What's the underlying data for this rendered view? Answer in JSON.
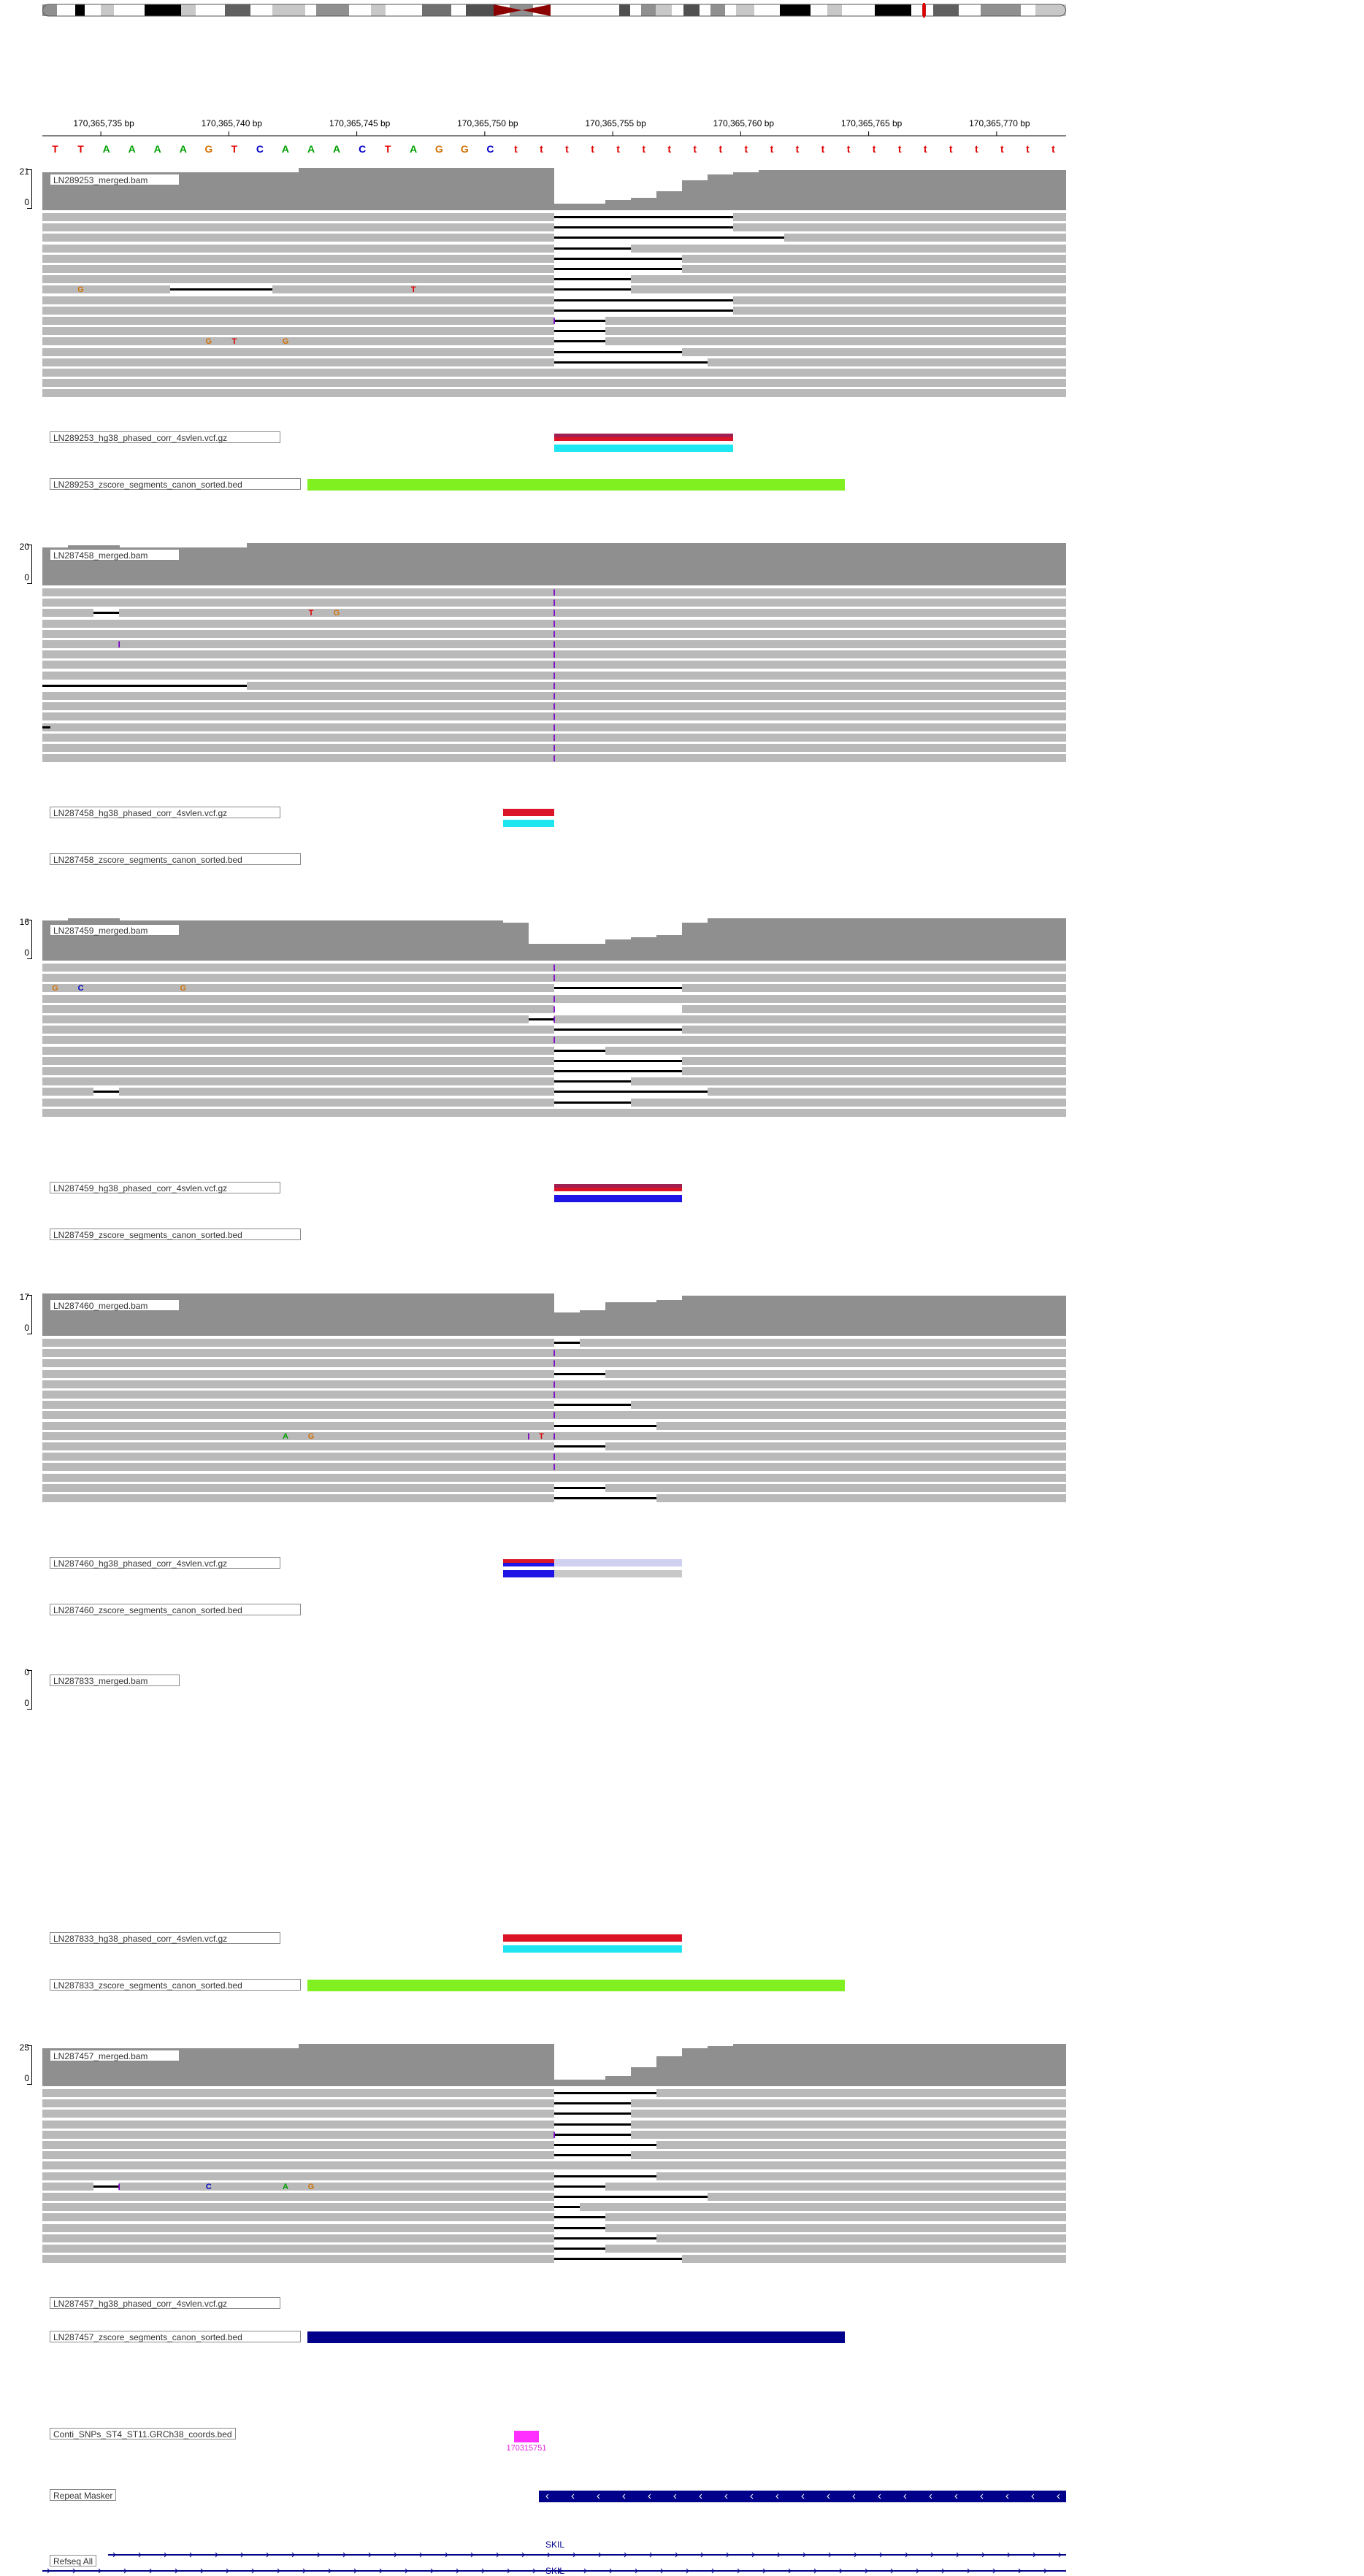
{
  "ruler": {
    "positions": [
      "170,365,735 bp",
      "170,365,740 bp",
      "170,365,745 bp",
      "170,365,750 bp",
      "170,365,755 bp",
      "170,365,760 bp",
      "170,365,765 bp",
      "170,365,770 bp"
    ]
  },
  "sequence": {
    "bases": [
      "T",
      "T",
      "A",
      "A",
      "A",
      "A",
      "G",
      "T",
      "C",
      "A",
      "A",
      "A",
      "C",
      "T",
      "A",
      "G",
      "G",
      "C",
      "t",
      "t",
      "t",
      "t",
      "t",
      "t",
      "t",
      "t",
      "t",
      "t",
      "t",
      "t",
      "t",
      "t",
      "t",
      "t",
      "t",
      "t",
      "t",
      "t",
      "t",
      "t"
    ],
    "colors": {
      "A": "#00a000",
      "C": "#0000c8",
      "G": "#d17105",
      "T": "#e00000",
      "t": "#e00000"
    }
  },
  "samples": [
    {
      "id": "LN289253",
      "bam_label": "LN289253_merged.bam",
      "scale_max": "21",
      "scale_min": "0",
      "vcf_label": "LN289253_hg38_phased_corr_4svlen.vcf.gz",
      "bed_label": "LN289253_zscore_segments_canon_sorted.bed",
      "coverage": [
        0.9,
        0.9,
        0.9,
        0.9,
        0.9,
        0.9,
        0.9,
        0.9,
        0.9,
        0.9,
        1,
        1,
        1,
        1,
        1,
        1,
        1,
        1,
        1,
        1,
        0.15,
        0.15,
        0.25,
        0.3,
        0.45,
        0.7,
        0.85,
        0.9,
        0.95,
        0.95,
        0.95,
        0.95,
        0.95,
        0.95,
        0.95,
        0.95,
        0.95,
        0.95,
        0.95,
        0.95
      ]
    },
    {
      "id": "LN287458",
      "bam_label": "LN287458_merged.bam",
      "scale_max": "20",
      "scale_min": "0",
      "vcf_label": "LN287458_hg38_phased_corr_4svlen.vcf.gz",
      "bed_label": "LN287458_zscore_segments_canon_sorted.bed",
      "coverage": [
        0.9,
        0.95,
        0.95,
        0.9,
        0.9,
        0.9,
        0.9,
        0.9,
        1,
        1,
        1,
        1,
        1,
        1,
        1,
        1,
        1,
        1,
        1,
        1,
        1,
        1,
        1,
        1,
        1,
        1,
        1,
        1,
        1,
        1,
        1,
        1,
        1,
        1,
        1,
        1,
        1,
        1,
        1,
        1
      ]
    },
    {
      "id": "LN287459",
      "bam_label": "LN287459_merged.bam",
      "scale_max": "16",
      "scale_min": "0",
      "vcf_label": "LN287459_hg38_phased_corr_4svlen.vcf.gz",
      "bed_label": "LN287459_zscore_segments_canon_sorted.bed",
      "coverage": [
        0.95,
        1,
        1,
        0.95,
        0.95,
        0.95,
        0.95,
        0.95,
        0.95,
        0.95,
        0.95,
        0.95,
        0.95,
        0.95,
        0.95,
        0.95,
        0.95,
        0.95,
        0.9,
        0.4,
        0.4,
        0.4,
        0.5,
        0.55,
        0.6,
        0.9,
        1,
        1,
        1,
        1,
        1,
        1,
        1,
        1,
        1,
        1,
        1,
        1,
        1,
        1
      ]
    },
    {
      "id": "LN287460",
      "bam_label": "LN287460_merged.bam",
      "scale_max": "17",
      "scale_min": "0",
      "vcf_label": "LN287460_hg38_phased_corr_4svlen.vcf.gz",
      "bed_label": "LN287460_zscore_segments_canon_sorted.bed",
      "coverage": [
        1,
        1,
        1,
        1,
        1,
        1,
        1,
        1,
        1,
        1,
        1,
        1,
        1,
        1,
        1,
        1,
        1,
        1,
        1,
        1,
        0.55,
        0.6,
        0.8,
        0.8,
        0.85,
        0.95,
        0.95,
        0.95,
        0.95,
        0.95,
        0.95,
        0.95,
        0.95,
        0.95,
        0.95,
        0.95,
        0.95,
        0.95,
        0.95,
        0.95
      ]
    },
    {
      "id": "LN287833",
      "bam_label": "LN287833_merged.bam",
      "scale_max": "0",
      "scale_min": "0",
      "vcf_label": "LN287833_hg38_phased_corr_4svlen.vcf.gz",
      "bed_label": "LN287833_zscore_segments_canon_sorted.bed",
      "coverage": []
    },
    {
      "id": "LN287457",
      "bam_label": "LN287457_merged.bam",
      "scale_max": "25",
      "scale_min": "0",
      "vcf_label": "LN287457_hg38_phased_corr_4svlen.vcf.gz",
      "bed_label": "LN287457_zscore_segments_canon_sorted.bed",
      "coverage": [
        0.9,
        0.9,
        0.9,
        0.9,
        0.9,
        0.9,
        0.9,
        0.9,
        0.9,
        0.9,
        1,
        1,
        1,
        1,
        1,
        1,
        1,
        1,
        1,
        1,
        0.15,
        0.15,
        0.25,
        0.45,
        0.7,
        0.9,
        0.95,
        1,
        1,
        1,
        1,
        1,
        1,
        1,
        1,
        1,
        1,
        1,
        1,
        1
      ]
    }
  ],
  "annotation_tracks": {
    "snps_label": "Conti_SNPs_ST4_ST11.GRCh38_coords.bed",
    "snp_feature_label": "170315751",
    "repeat_label": "Repeat Masker",
    "refseq_label": "Refseq All",
    "gene_name": "SKIL"
  },
  "colors": {
    "coverage": "#8f8f8f",
    "read": "#b9b9b9",
    "lime": "#80f020",
    "navy": "#00008b",
    "red": "#dc1428",
    "maroon": "#a01e50",
    "cyan": "#1ee6f0",
    "blue": "#1e14e6",
    "magenta": "#ff30ff",
    "lavender": "#d0d0f0",
    "lightgray": "#c8c8c8"
  },
  "icons": [
    "chromosome-ideogram",
    "centromere-icon",
    "insertion-marker-icon",
    "strand-arrow-icon"
  ]
}
